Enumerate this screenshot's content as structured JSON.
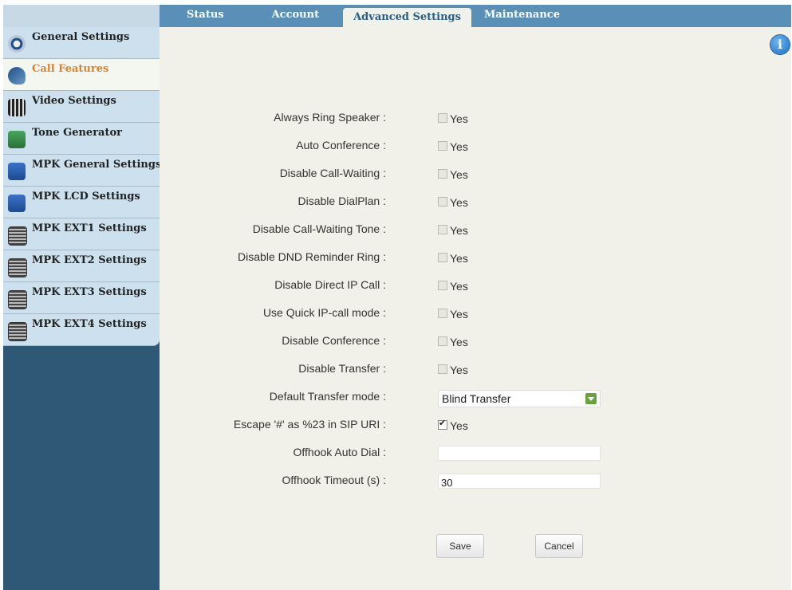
{
  "tabs": [
    {
      "label": "Status"
    },
    {
      "label": "Account"
    },
    {
      "label": "Advanced Settings"
    },
    {
      "label": "Maintenance"
    }
  ],
  "sidebar": {
    "items": [
      {
        "label": "General Settings",
        "icon": "general-settings-icon"
      },
      {
        "label": "Call Features",
        "icon": "call-features-icon",
        "active": true
      },
      {
        "label": "Video Settings",
        "icon": "video-settings-icon"
      },
      {
        "label": "Tone Generator",
        "icon": "tone-generator-icon"
      },
      {
        "label": "MPK General Settings",
        "icon": "mpk-icon"
      },
      {
        "label": "MPK LCD Settings",
        "icon": "mpk-icon"
      },
      {
        "label": "MPK EXT1 Settings",
        "icon": "extension-module-icon"
      },
      {
        "label": "MPK EXT2 Settings",
        "icon": "extension-module-icon"
      },
      {
        "label": "MPK EXT3 Settings",
        "icon": "extension-module-icon"
      },
      {
        "label": "MPK EXT4 Settings",
        "icon": "extension-module-icon"
      }
    ]
  },
  "form": {
    "rows": [
      {
        "label": "Always Ring Speaker :",
        "type": "checkbox",
        "option": "Yes",
        "checked": false
      },
      {
        "label": "Auto Conference :",
        "type": "checkbox",
        "option": "Yes",
        "checked": false
      },
      {
        "label": "Disable Call-Waiting :",
        "type": "checkbox",
        "option": "Yes",
        "checked": false
      },
      {
        "label": "Disable DialPlan :",
        "type": "checkbox",
        "option": "Yes",
        "checked": false
      },
      {
        "label": "Disable Call-Waiting Tone :",
        "type": "checkbox",
        "option": "Yes",
        "checked": false
      },
      {
        "label": "Disable DND Reminder Ring :",
        "type": "checkbox",
        "option": "Yes",
        "checked": false
      },
      {
        "label": "Disable Direct IP Call :",
        "type": "checkbox",
        "option": "Yes",
        "checked": false
      },
      {
        "label": "Use Quick IP-call mode :",
        "type": "checkbox",
        "option": "Yes",
        "checked": false
      },
      {
        "label": "Disable Conference :",
        "type": "checkbox",
        "option": "Yes",
        "checked": false
      },
      {
        "label": "Disable Transfer :",
        "type": "checkbox",
        "option": "Yes",
        "checked": false
      },
      {
        "label": "Default Transfer mode :",
        "type": "select",
        "value": "Blind Transfer"
      },
      {
        "label": "Escape '#' as %23 in SIP URI :",
        "type": "checkbox",
        "option": "Yes",
        "checked": true
      },
      {
        "label": "Offhook Auto Dial :",
        "type": "text",
        "value": ""
      },
      {
        "label": "Offhook Timeout (s) :",
        "type": "text",
        "value": "30"
      }
    ],
    "save_label": "Save",
    "cancel_label": "Cancel"
  },
  "info_icon": "i",
  "colors": {
    "topbar": "#5a90b8",
    "sidebar_bg": "#2f5877",
    "sidebar_item": "#cde0ee",
    "active_label": "#e0822e",
    "main_bg": "#f1f1e9"
  }
}
